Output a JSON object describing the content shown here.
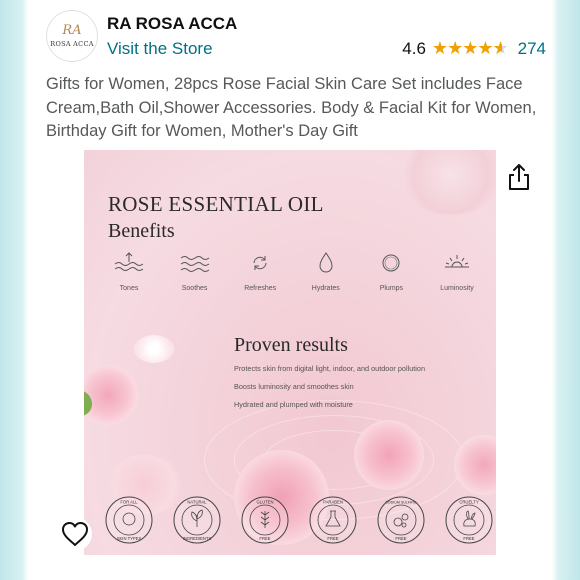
{
  "store": {
    "logo_text": "ROSA ACCA",
    "logo_mark": "RA",
    "name": "RA ROSA ACCA",
    "visit_label": "Visit the Store",
    "rating": "4.6",
    "rating_value": 4.6,
    "rating_count": "274",
    "star_color": "#f0a000"
  },
  "product": {
    "title": "Gifts for Women, 28pcs Rose Facial Skin Care Set includes Face Cream,Bath Oil,Shower Accessories. Body & Facial Kit for Women, Birthday Gift for Women, Mother's Day Gift"
  },
  "hero": {
    "heading": "ROSE ESSENTIAL OIL",
    "subheading": "Benefits",
    "benefits": [
      {
        "label": "Tones",
        "icon": "waves-arrow-icon"
      },
      {
        "label": "Soothes",
        "icon": "waves-icon"
      },
      {
        "label": "Refreshes",
        "icon": "refresh-icon"
      },
      {
        "label": "Hydrates",
        "icon": "droplet-icon"
      },
      {
        "label": "Plumps",
        "icon": "circle-icon"
      },
      {
        "label": "Luminosity",
        "icon": "sun-icon"
      }
    ],
    "proven_title": "Proven results",
    "proven_items": [
      "Protects skin from digital light, indoor, and outdoor pollution",
      "Boosts luminosity and smoothes skin",
      "Hydrated and plumped with moisture"
    ],
    "badges": [
      {
        "top": "FOR ALL",
        "bottom": "SKIN TYPES",
        "icon": "face-icon"
      },
      {
        "top": "NATURAL",
        "bottom": "INGREDIENTS",
        "icon": "leaf-icon"
      },
      {
        "top": "GLUTEN",
        "bottom": "FREE",
        "icon": "wheat-icon"
      },
      {
        "top": "PARABEN",
        "bottom": "FREE",
        "icon": "flask-icon"
      },
      {
        "top": "SODIUM SULFATE",
        "bottom": "FREE",
        "icon": "bubbles-icon"
      },
      {
        "top": "CRUELTY",
        "bottom": "FREE",
        "icon": "rabbit-icon"
      }
    ]
  },
  "actions": {
    "share_icon": "share-icon",
    "wishlist_icon": "heart-icon"
  },
  "colors": {
    "link": "#007185",
    "hero_pink": "#f4d3db"
  }
}
